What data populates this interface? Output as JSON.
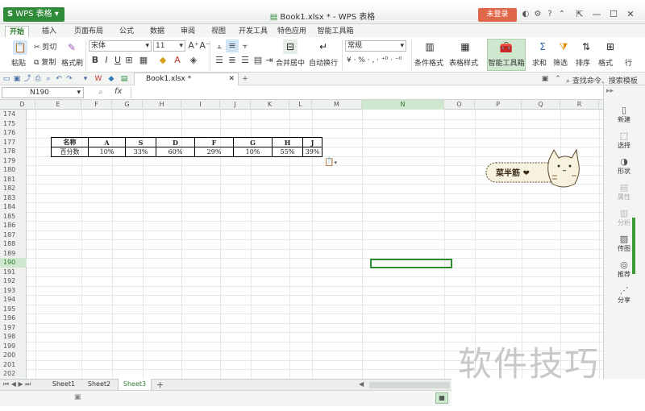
{
  "app": {
    "name": "WPS 表格",
    "logo": "S",
    "title": "Book1.xlsx * - WPS 表格",
    "login_label": "未登录"
  },
  "ribbon_tabs": [
    "开始",
    "插入",
    "页面布局",
    "公式",
    "数据",
    "审阅",
    "视图",
    "开发工具",
    "特色应用",
    "智能工具箱"
  ],
  "ribbon": {
    "paste": "粘贴",
    "cut": "剪切",
    "copy": "复制",
    "format_painter": "格式刷",
    "font_name": "宋体",
    "font_size": "11",
    "merge_center": "合并居中",
    "wrap_text": "自动换行",
    "number_format": "常规",
    "cond_format": "条件格式",
    "table_style": "表格样式",
    "smart_toolbox": "智能工具箱",
    "sum": "求和",
    "filter": "筛选",
    "sort": "排序",
    "format": "格式",
    "row": "行"
  },
  "quickbar": {
    "file_tab": "Book1.xlsx *",
    "search": "查找命令、搜索模板"
  },
  "formula": {
    "cell_ref": "N190",
    "fx": "fx",
    "value": ""
  },
  "columns": [
    "D",
    "E",
    "F",
    "G",
    "H",
    "I",
    "J",
    "K",
    "L",
    "M",
    "N",
    "O",
    "P",
    "Q",
    "R"
  ],
  "selected_column": "N",
  "rows": [
    "174",
    "175",
    "176",
    "177",
    "178",
    "179",
    "180",
    "181",
    "182",
    "183",
    "184",
    "185",
    "186",
    "187",
    "188",
    "189",
    "190",
    "191",
    "192",
    "193",
    "194",
    "195",
    "196",
    "197",
    "198",
    "199",
    "200",
    "201",
    "202"
  ],
  "selected_row": "190",
  "table": {
    "header": [
      "名称",
      "A",
      "S",
      "D",
      "F",
      "G",
      "H",
      "J"
    ],
    "row": [
      "百分数",
      "10%",
      "33%",
      "60%",
      "29%",
      "10%",
      "55%",
      "39%"
    ]
  },
  "sticker_text": "菜半筋 ❤",
  "right_panel": [
    {
      "icon": "new-icon",
      "label": "新建",
      "enabled": true
    },
    {
      "icon": "select-icon",
      "label": "选择",
      "enabled": true
    },
    {
      "icon": "shape-icon",
      "label": "形状",
      "enabled": true
    },
    {
      "icon": "property-icon",
      "label": "属性",
      "enabled": false
    },
    {
      "icon": "analysis-icon",
      "label": "分析",
      "enabled": false
    },
    {
      "icon": "image-icon",
      "label": "传图",
      "enabled": true
    },
    {
      "icon": "recommend-icon",
      "label": "推荐",
      "enabled": true
    },
    {
      "icon": "share-icon",
      "label": "分享",
      "enabled": true
    }
  ],
  "sheets": [
    "Sheet1",
    "Sheet2",
    "Sheet3"
  ],
  "active_sheet": "Sheet3",
  "watermark": "软件技巧"
}
